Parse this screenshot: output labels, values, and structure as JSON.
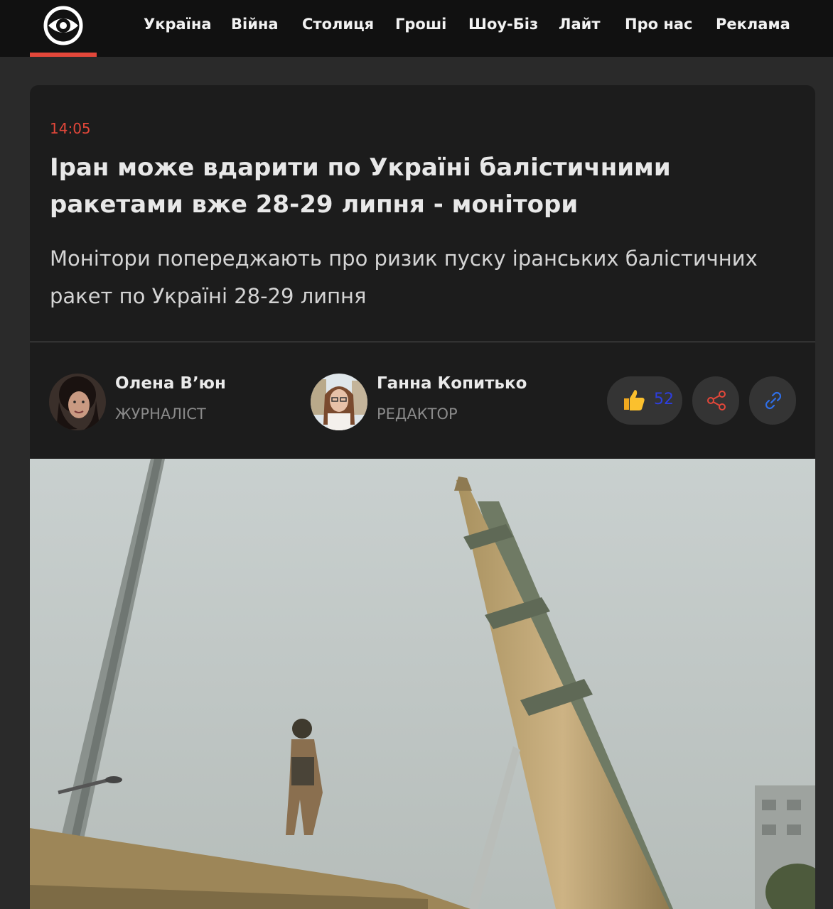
{
  "nav": {
    "items": [
      {
        "label": "Україна"
      },
      {
        "label": "Війна"
      },
      {
        "label": "Столиця"
      },
      {
        "label": "Гроші"
      },
      {
        "label": "Шоу-Біз"
      },
      {
        "label": "Лайт"
      },
      {
        "label": "Про нас"
      },
      {
        "label": "Реклама"
      }
    ],
    "logo_icon": "eye-logo-icon"
  },
  "article": {
    "time": "14:05",
    "title": "Іран може вдарити по Україні балістичними ракетами вже 28-29 липня - монітори",
    "lead": "Монітори попереджають про ризик пуску іранських балістичних ракет по Україні 28-29 липня"
  },
  "authors": [
    {
      "name": "Олена В’юн",
      "role": "ЖУРНАЛІСТ"
    },
    {
      "name": "Ганна Копитько",
      "role": "РЕДАКТОР"
    }
  ],
  "actions": {
    "like_icon": "thumbs-up-icon",
    "like_count": "52",
    "share_icon": "share-icon",
    "link_icon": "link-icon"
  },
  "colors": {
    "accent": "#e3473a",
    "background": "#2a2a2a",
    "card": "#1c1c1c",
    "topbar": "#111111",
    "like_count": "#2d3ee0",
    "link_icon": "#2f6fe8"
  }
}
